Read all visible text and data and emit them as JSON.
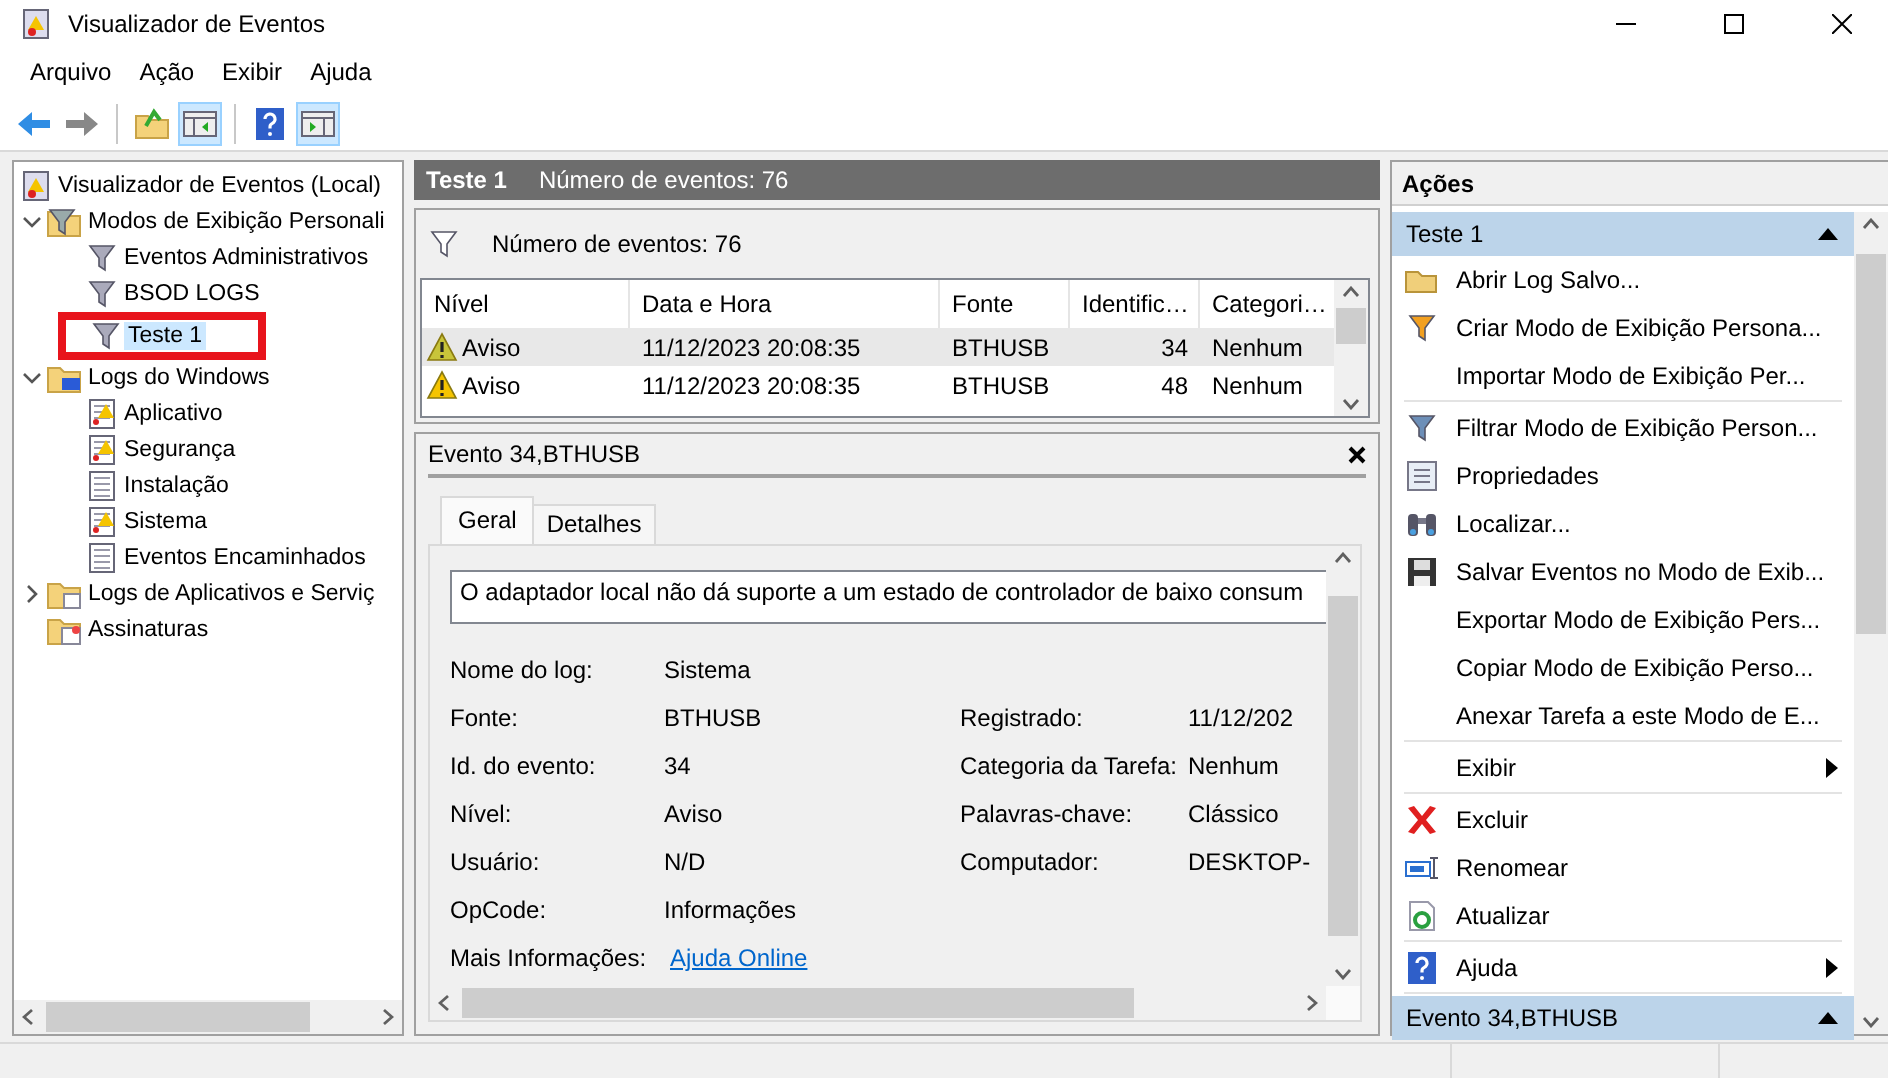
{
  "window": {
    "title": "Visualizador de Eventos"
  },
  "menu": [
    "Arquivo",
    "Ação",
    "Exibir",
    "Ajuda"
  ],
  "toolbar": [
    [
      {
        "kind": "back",
        "pressed": false
      },
      {
        "kind": "forward",
        "pressed": false
      }
    ],
    [
      {
        "kind": "up-folder",
        "pressed": false
      },
      {
        "kind": "console-tree",
        "pressed": true
      }
    ],
    [
      {
        "kind": "help",
        "pressed": false
      },
      {
        "kind": "action-pane",
        "pressed": true
      }
    ]
  ],
  "tree": [
    {
      "label": "Visualizador de Eventos (Local)",
      "kind": "root",
      "selected": false,
      "children": [
        {
          "label": "Modos de Exibição Personali",
          "kind": "view-folder",
          "selected": false,
          "expanded": true,
          "children": [
            {
              "label": "Eventos Administrativos",
              "kind": "filter",
              "selected": false
            },
            {
              "label": "BSOD LOGS",
              "kind": "filter",
              "selected": false
            },
            {
              "label": "Teste 1",
              "kind": "filter",
              "selected": true,
              "highlighted": true
            }
          ]
        },
        {
          "label": "Logs do Windows",
          "kind": "windows-folder",
          "selected": false,
          "expanded": true,
          "children": [
            {
              "label": "Aplicativo",
              "kind": "log-warn",
              "selected": false
            },
            {
              "label": "Segurança",
              "kind": "log-warn",
              "selected": false
            },
            {
              "label": "Instalação",
              "kind": "log",
              "selected": false
            },
            {
              "label": "Sistema",
              "kind": "log-warn",
              "selected": false
            },
            {
              "label": "Eventos Encaminhados",
              "kind": "log",
              "selected": false
            }
          ]
        },
        {
          "label": "Logs de Aplicativos e Serviç",
          "kind": "folder",
          "selected": false,
          "expanded": false
        },
        {
          "label": "Assinaturas",
          "kind": "subscriptions",
          "selected": false
        }
      ]
    }
  ],
  "log_view": {
    "title": "Teste 1",
    "count": "Número de eventos: 76",
    "filter_text": "Número de eventos: 76",
    "columns": [
      "Nível",
      "Data e Hora",
      "Fonte",
      "Identific…",
      "Categori…"
    ],
    "rows": [
      {
        "kind": "warning",
        "level": "Aviso",
        "date": "11/12/2023 20:08:35",
        "source": "BTHUSB",
        "id": "34",
        "category": "Nenhum",
        "selected": true
      },
      {
        "kind": "warning",
        "level": "Aviso",
        "date": "11/12/2023 20:08:35",
        "source": "BTHUSB",
        "id": "48",
        "category": "Nenhum",
        "selected": false
      }
    ]
  },
  "details": {
    "title": "Evento 34,BTHUSB",
    "tabs": [
      {
        "label": "Geral",
        "selected": true
      },
      {
        "label": "Detalhes",
        "selected": false
      }
    ],
    "description": "O adaptador local não dá suporte a um estado de controlador de baixo consum",
    "rows": [
      {
        "left": {
          "label": "Nome do log:",
          "value": "Sistema"
        }
      },
      {
        "left": {
          "label": "Fonte:",
          "value": "BTHUSB"
        },
        "right": {
          "label": "Registrado:",
          "value": "11/12/202"
        }
      },
      {
        "left": {
          "label": "Id. do evento:",
          "value": "34"
        },
        "right": {
          "label": "Categoria da Tarefa:",
          "value": "Nenhum"
        }
      },
      {
        "left": {
          "label": "Nível:",
          "value": "Aviso"
        },
        "right": {
          "label": "Palavras-chave:",
          "value": "Clássico"
        }
      },
      {
        "left": {
          "label": "Usuário:",
          "value": "N/D"
        },
        "right": {
          "label": "Computador:",
          "value": "DESKTOP-"
        }
      },
      {
        "left": {
          "label": "OpCode:",
          "value": "Informações"
        }
      },
      {
        "left": {
          "label": "Mais Informações:",
          "value": "Ajuda Online",
          "kind": "link"
        }
      }
    ]
  },
  "actions": {
    "title": "Ações",
    "sections": [
      {
        "title": "Teste 1",
        "expanded": true,
        "groups": [
          [
            {
              "label": "Abrir Log Salvo...",
              "kind": "open"
            },
            {
              "label": "Criar Modo de Exibição Persona...",
              "kind": "new-filter"
            },
            {
              "label": "Importar Modo de Exibição Per...",
              "kind": "none"
            }
          ],
          [
            {
              "label": "Filtrar Modo de Exibição Person...",
              "kind": "filter"
            },
            {
              "label": "Propriedades",
              "kind": "properties"
            },
            {
              "label": "Localizar...",
              "kind": "find"
            },
            {
              "label": "Salvar Eventos no Modo de Exib...",
              "kind": "save"
            },
            {
              "label": "Exportar Modo de Exibição Pers...",
              "kind": "none"
            },
            {
              "label": "Copiar Modo de Exibição Perso...",
              "kind": "none"
            },
            {
              "label": "Anexar Tarefa a este Modo de E...",
              "kind": "none"
            }
          ],
          [
            {
              "label": "Exibir",
              "kind": "none",
              "submenu": true
            }
          ],
          [
            {
              "label": "Excluir",
              "kind": "delete"
            },
            {
              "label": "Renomear",
              "kind": "rename"
            },
            {
              "label": "Atualizar",
              "kind": "refresh"
            }
          ],
          [
            {
              "label": "Ajuda",
              "kind": "help",
              "submenu": true
            }
          ]
        ]
      },
      {
        "title": "Evento 34,BTHUSB",
        "expanded": true
      }
    ]
  }
}
